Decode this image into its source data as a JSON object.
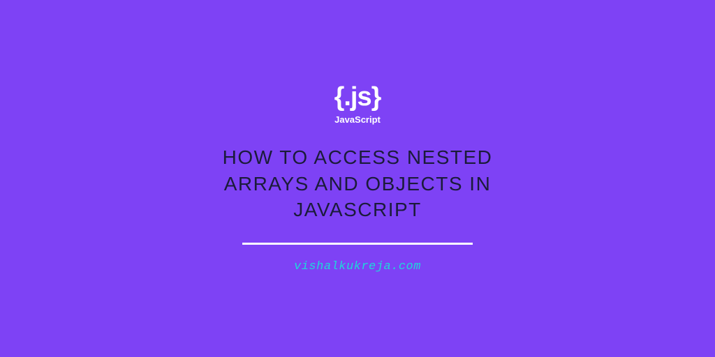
{
  "logo": {
    "text": "{.js}",
    "subtitle": "JavaScript"
  },
  "title": "HOW TO ACCESS NESTED ARRAYS AND OBJECTS IN JAVASCRIPT",
  "website": "vishalkukreja.com",
  "colors": {
    "background": "#7e42f5",
    "logo": "#ffffff",
    "title": "#1b1b3a",
    "divider": "#ffffff",
    "website": "#1ed9d9"
  }
}
